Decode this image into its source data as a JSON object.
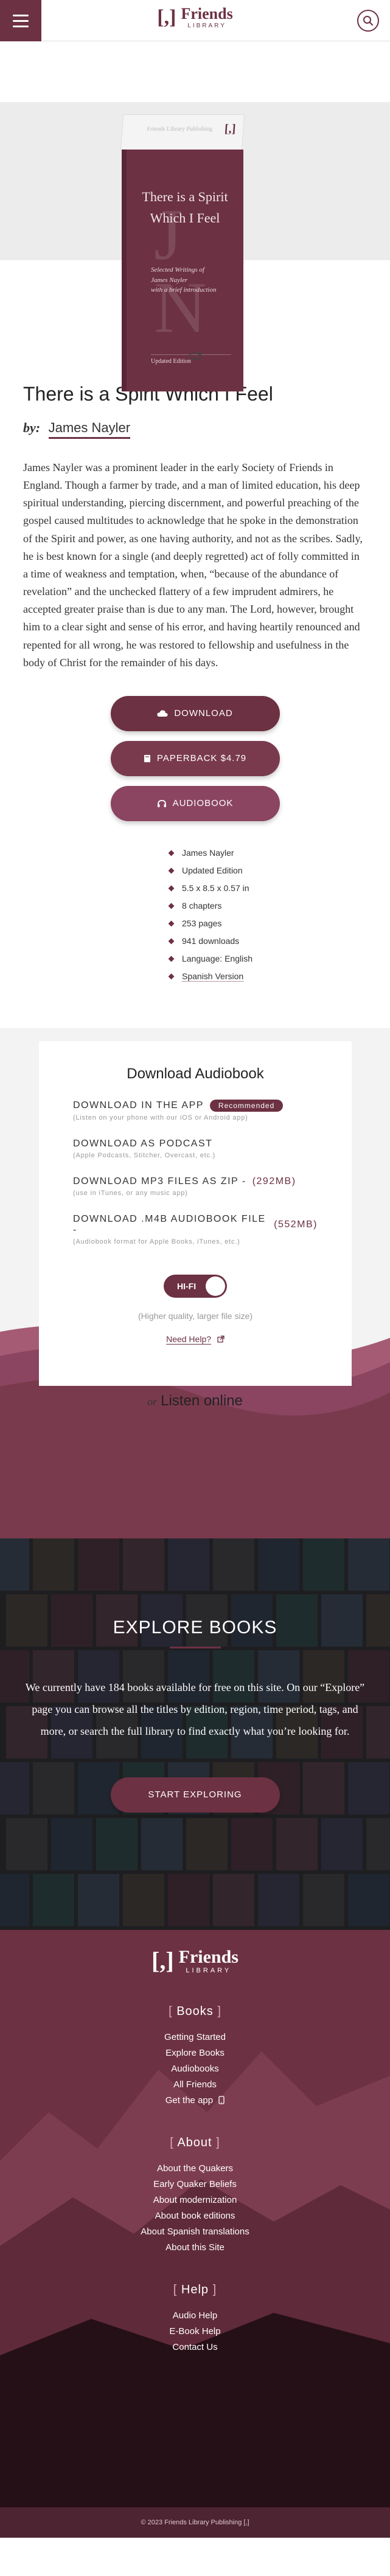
{
  "header": {
    "logo_mark": "[,]",
    "logo_title": "Friends",
    "logo_subtitle": "LIBRARY"
  },
  "cover": {
    "spine_publisher": "Friends Library Publishing",
    "spine_mark": "[,]",
    "title_line1": "There is a Spirit",
    "title_line2": "Which I Feel",
    "initials": "J N",
    "subtitle_line1": "Selected Writings of",
    "subtitle_line2": "James Nayler",
    "subtitle_line3": "with a brief introduction",
    "edition_line": "Updated Edition"
  },
  "book": {
    "title": "There is a Spirit Which I Feel",
    "by_label": "by:",
    "author": "James Nayler",
    "description": "James Nayler was a prominent leader in the early Society of Friends in England. Though a farmer by trade, and a man of limited education, his deep spiritual understanding, piercing discernment, and powerful preaching of the gospel caused multitudes to acknowledge that he spoke in the demonstration of the Spirit and power, as one having authority, and not as the scribes. Sadly, he is best known for a single (and deeply regretted) act of folly committed in a time of weakness and temptation, when, “because of the abundance of revelation” and the unchecked flattery of a few imprudent admirers, he accepted greater praise than is due to any man. The Lord, however, brought him to a clear sight and sense of his error, and having heartily renounced and repented for all wrong, he was restored to fellowship and usefulness in the body of Christ for the remainder of his days."
  },
  "actions": {
    "download": "DOWNLOAD",
    "paperback": "PAPERBACK $4.79",
    "audiobook": "AUDIOBOOK"
  },
  "meta": {
    "author": "James Nayler",
    "edition": "Updated Edition",
    "dimensions": "5.5 x 8.5 x 0.57 in",
    "chapters": "8 chapters",
    "pages": "253 pages",
    "downloads": "941 downloads",
    "language": "Language: English",
    "spanish": "Spanish Version"
  },
  "audio": {
    "heading": "Download Audiobook",
    "app_title": "DOWNLOAD IN THE APP",
    "app_badge": "Recommended",
    "app_sub": "(Listen on your phone with our iOS or Android app)",
    "podcast_title": "DOWNLOAD AS PODCAST",
    "podcast_sub": "(Apple Podcasts, Stitcher, Overcast, etc.)",
    "mp3_title": "DOWNLOAD MP3 FILES AS ZIP -",
    "mp3_size": "(292MB)",
    "mp3_sub": "(use in iTunes, or any music app)",
    "m4b_title": "DOWNLOAD .M4B AUDIOBOOK FILE -",
    "m4b_size": "(552MB)",
    "m4b_sub": "(Audiobook format for Apple Books, iTunes, etc.)",
    "toggle_label": "HI-FI",
    "quality_note": "(Higher quality, larger file size)",
    "help": "Need Help?",
    "listen_or": "or",
    "listen_online": "Listen online"
  },
  "explore": {
    "heading": "EXPLORE BOOKS",
    "text": "We currently have 184 books available for free on this site. On our “Explore” page you can browse all the titles by edition, region, time period, tags, and more, or search the full library to find exactly what you’re looking for.",
    "button": "START EXPLORING"
  },
  "footer": {
    "logo_mark": "[,]",
    "logo_title": "Friends",
    "logo_subtitle": "LIBRARY",
    "books_heading": "Books",
    "books_links": [
      "Getting Started",
      "Explore Books",
      "Audiobooks",
      "All Friends",
      "Get the app"
    ],
    "about_heading": "About",
    "about_links": [
      "About the Quakers",
      "Early Quaker Beliefs",
      "About modernization",
      "About book editions",
      "About Spanish translations",
      "About this Site"
    ],
    "help_heading": "Help",
    "help_links": [
      "Audio Help",
      "E-Book Help",
      "Contact Us"
    ],
    "copyright": "© 2023 Friends Library Publishing [,]"
  },
  "colors": {
    "brand": "#6c3142",
    "brand_dark": "#4d2431",
    "explore_bg": "#2a2a2a"
  },
  "icons": {
    "menu": "hamburger-icon",
    "search": "search-icon",
    "rotate": "rotate-icon",
    "download": "cloud-download-icon",
    "paperback": "book-icon",
    "audiobook": "headphones-icon",
    "help": "external-link-icon",
    "phone": "phone-icon"
  }
}
